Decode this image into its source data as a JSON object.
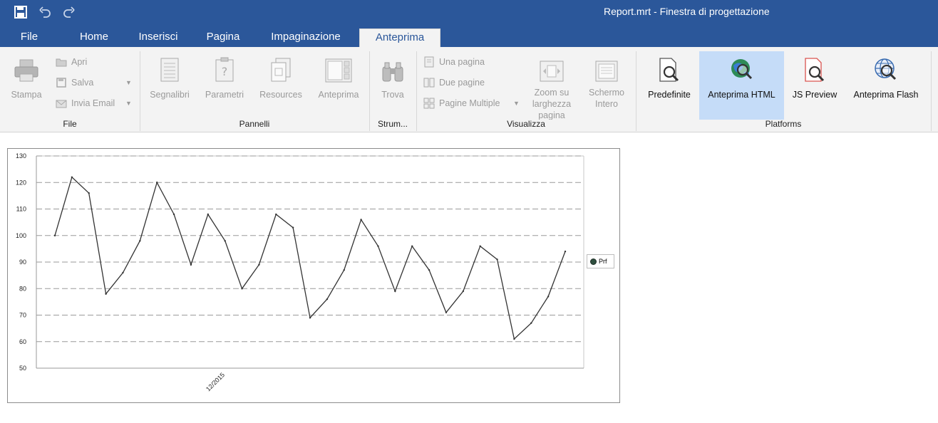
{
  "window": {
    "title": "Report.mrt - Finestra di progettazione"
  },
  "tabs": [
    {
      "label": "File"
    },
    {
      "label": "Home"
    },
    {
      "label": "Inserisci"
    },
    {
      "label": "Pagina"
    },
    {
      "label": "Impaginazione"
    },
    {
      "label": "Anteprima"
    }
  ],
  "ribbon": {
    "file": {
      "group_label": "File",
      "stampa": "Stampa",
      "apri": "Apri",
      "salva": "Salva",
      "invia_email": "Invia Email"
    },
    "pannelli": {
      "group_label": "Pannelli",
      "segnalibri": "Segnalibri",
      "parametri": "Parametri",
      "resources": "Resources",
      "anteprima": "Anteprima"
    },
    "strumenti": {
      "group_label": "Strum...",
      "trova": "Trova"
    },
    "visualizza": {
      "group_label": "Visualizza",
      "una_pagina": "Una pagina",
      "due_pagine": "Due pagine",
      "pagine_multiple": "Pagine Multiple",
      "zoom_line1": "Zoom su",
      "zoom_line2": "larghezza",
      "zoom_line3": "pagina",
      "schermo_line1": "Schermo",
      "schermo_line2": "Intero"
    },
    "platforms": {
      "group_label": "Platforms",
      "predefinite": "Predefinite",
      "anteprima_html": "Anteprima HTML",
      "js_preview": "JS Preview",
      "anteprima_flash": "Anteprima Flash"
    }
  },
  "colors": {
    "accent": "#2b579a",
    "ribbon_bg": "#f3f3f3",
    "highlight": "#c5dcf8",
    "line": "#333333",
    "grid": "#9a9a9a"
  },
  "chart_data": {
    "type": "line",
    "title": "",
    "xlabel": "",
    "ylabel": "",
    "ylim": [
      50,
      130
    ],
    "yticks": [
      50,
      60,
      70,
      80,
      90,
      100,
      110,
      120,
      130
    ],
    "x_tick_labels": [
      {
        "index": 10,
        "label": "12/2015"
      }
    ],
    "grid": "horizontal dashed",
    "legend_position": "right",
    "series": [
      {
        "name": "Prf",
        "values": [
          100,
          122,
          116,
          78,
          86,
          98,
          120,
          108,
          89,
          108,
          98,
          80,
          89,
          108,
          103,
          69,
          76,
          87,
          106,
          96,
          79,
          96,
          87,
          71,
          79,
          96,
          91,
          61,
          67,
          77,
          94
        ]
      }
    ]
  }
}
